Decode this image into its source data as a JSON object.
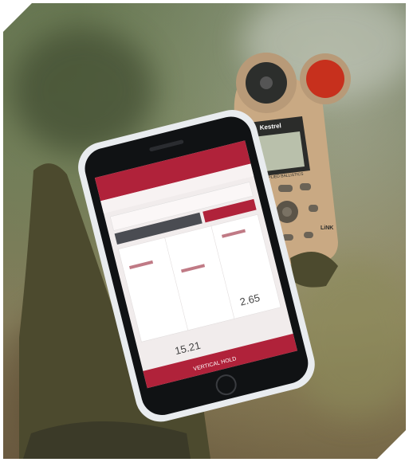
{
  "photo": {
    "subject": "gloved-hand-holding-smartphone-and-weather-meter"
  },
  "device": {
    "brand_logo_text": "Kestrel",
    "screen_caption": "APPLIED BALLISTICS",
    "badge_text": "LiNK"
  },
  "phone_app": {
    "result_left": "15.21",
    "result_right": "2.65",
    "primary_button_label": "VERTICAL HOLD"
  },
  "colors": {
    "app_accent": "#b0223a",
    "device_body": "#c9a983",
    "glove": "#4c4a2e"
  }
}
